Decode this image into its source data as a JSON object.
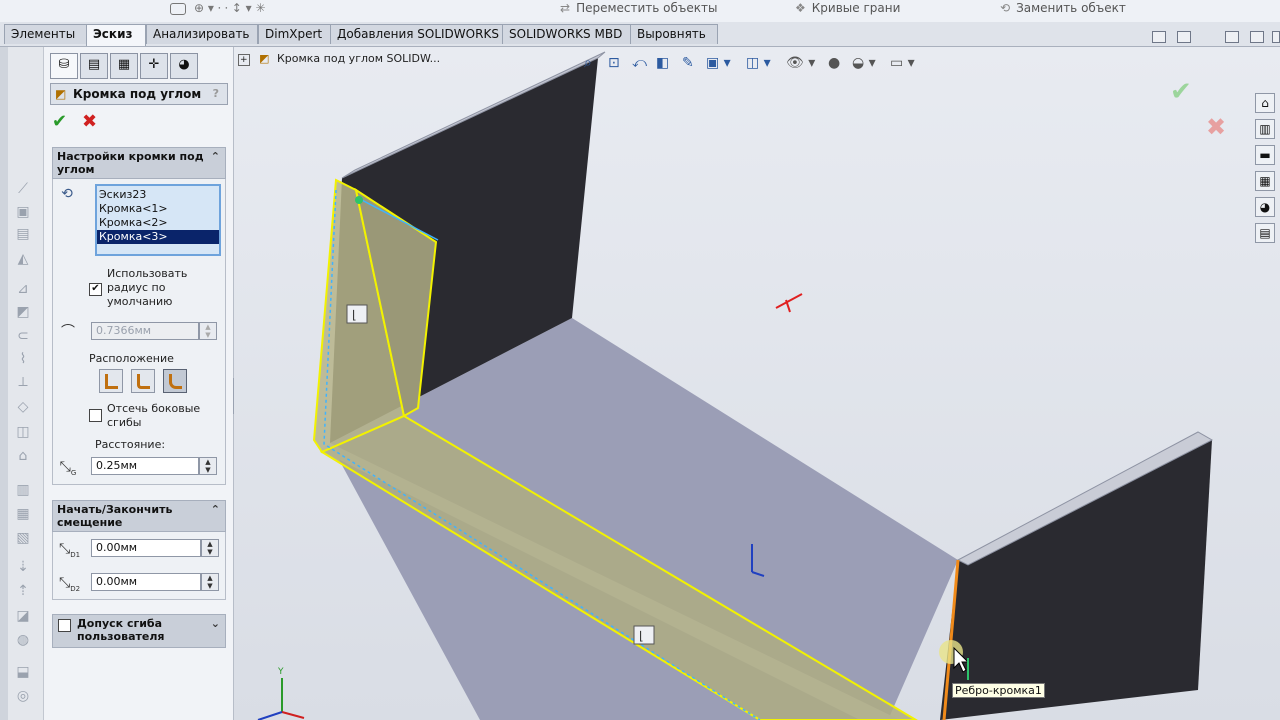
{
  "top_strip": {
    "items": [
      "Переместить объекты",
      "Кривые грани",
      "Заменить объект"
    ]
  },
  "tabs": [
    {
      "label": "Элементы",
      "active": false
    },
    {
      "label": "Эскиз",
      "active": true
    },
    {
      "label": "Анализировать",
      "active": false
    },
    {
      "label": "DimXpert",
      "active": false
    },
    {
      "label": "Добавления SOLIDWORKS",
      "active": false
    },
    {
      "label": "SOLIDWORKS MBD",
      "active": false
    },
    {
      "label": "Выровнять",
      "active": false
    }
  ],
  "property_manager": {
    "title": "Кромка под углом",
    "help": "?",
    "settings": {
      "header": "Настройки кромки под углом",
      "list_items": [
        "Эскиз23",
        "Кромка<1>",
        "Кромка<2>",
        "Кромка<3>"
      ],
      "selected_index": 3,
      "use_default_radius_label": "Использовать радиус по умолчанию",
      "use_default_radius_checked": true,
      "radius_value": "0.7366мм",
      "position_label": "Расположение",
      "trim_side_bends_label": "Отсечь боковые сгибы",
      "trim_side_bends_checked": false,
      "distance_label": "Расстояние:",
      "distance_value": "0.25мм"
    },
    "offset": {
      "header": "Начать/Закончить смещение",
      "d1_value": "0.00мм",
      "d2_value": "0.00мм",
      "d1_sub": "D1",
      "d2_sub": "D2",
      "g_sub": "G"
    },
    "bend_allowance": {
      "header": "Допуск сгиба пользователя",
      "checked": false
    }
  },
  "viewport": {
    "breadcrumb": "Кромка под углом SOLIDW...",
    "tooltip": "Ребро-кромка1",
    "triad_y": "Y"
  },
  "colors": {
    "selection_yellow": "#f2f200",
    "edge_orange": "#f08a1a",
    "panel_dark": "#2a2a30",
    "plate": "#9da0b6",
    "accept_green": "#3aa83a",
    "cancel_red": "#d02020"
  }
}
